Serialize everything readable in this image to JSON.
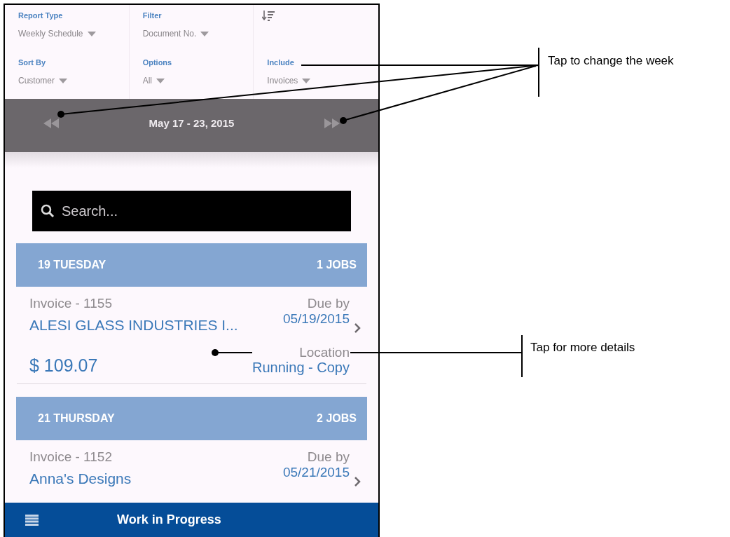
{
  "filters": [
    {
      "label": "Report Type",
      "value": "Weekly Schedule"
    },
    {
      "label": "Filter",
      "value": "Document No."
    },
    {
      "kind": "sort"
    },
    {
      "label": "Sort By",
      "value": "Customer"
    },
    {
      "label": "Options",
      "value": "All"
    },
    {
      "label": "Include",
      "value": "Invoices"
    }
  ],
  "week": {
    "title": "May 17 - 23, 2015"
  },
  "search": {
    "placeholder": "Search..."
  },
  "days": [
    {
      "title": "19 TUESDAY",
      "count": "1 JOBS",
      "jobs": [
        {
          "invoice": "Invoice - 1155",
          "customer": "ALESI GLASS INDUSTRIES I...",
          "due_label": "Due by",
          "due_date": "05/19/2015",
          "amount": "$ 109.07",
          "location_label": "Location",
          "location": "Running - Copy"
        }
      ]
    },
    {
      "title": "21 THURSDAY",
      "count": "2 JOBS",
      "jobs": [
        {
          "invoice": "Invoice - 1152",
          "customer": "Anna's Designs",
          "due_label": "Due by",
          "due_date": "05/21/2015"
        }
      ]
    }
  ],
  "bottom_bar": {
    "title": "Work in Progress"
  },
  "annotations": [
    "Tap to change the week",
    "Tap for more details"
  ]
}
